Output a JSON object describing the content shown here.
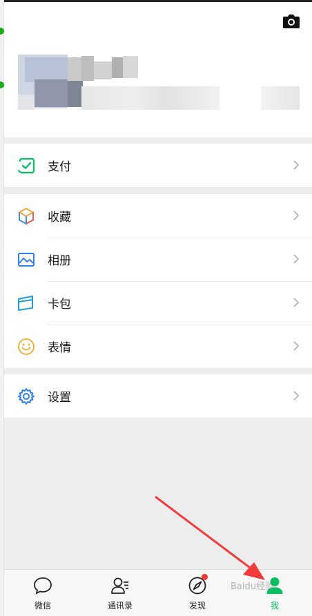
{
  "colors": {
    "accent": "#07c160",
    "background": "#ededed",
    "arrow": "#f23b3b",
    "badge": "#f43530"
  },
  "menu": {
    "pay": {
      "label": "支付",
      "icon": "wallet-check-icon"
    },
    "favorites": {
      "label": "收藏",
      "icon": "cube-icon"
    },
    "album": {
      "label": "相册",
      "icon": "photo-icon"
    },
    "cards": {
      "label": "卡包",
      "icon": "card-icon"
    },
    "stickers": {
      "label": "表情",
      "icon": "smiley-icon"
    },
    "settings": {
      "label": "设置",
      "icon": "gear-icon"
    }
  },
  "tabbar": {
    "chats": "微信",
    "contacts": "通讯录",
    "discover": "发现",
    "me": "我"
  },
  "watermark": "Baidu经验"
}
